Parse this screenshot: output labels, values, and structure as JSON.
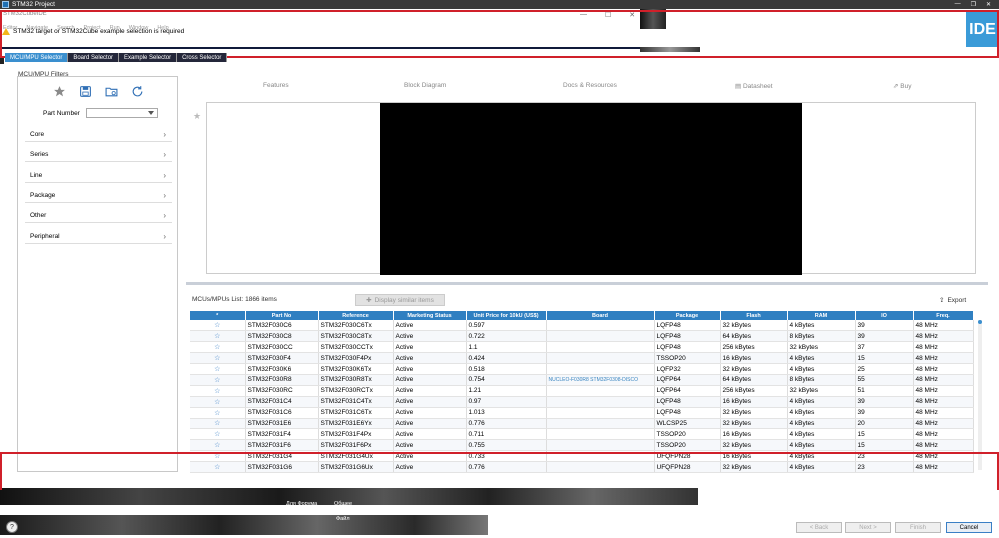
{
  "window": {
    "title": "STM32 Project"
  },
  "app": {
    "ide_name": "STM32CubeIDE",
    "menu": [
      "Editor",
      "Navigate",
      "Search",
      "Project",
      "Run",
      "Window",
      "Help"
    ],
    "badge": "IDE"
  },
  "wizard": {
    "warning": "STM32 target or STM32Cube example selection is required",
    "tabs": [
      "MCU/MPU Selector",
      "Board Selector",
      "Example Selector",
      "Cross Selector"
    ],
    "active_tab_index": 0
  },
  "filters": {
    "title": "MCU/MPU Filters",
    "icons": [
      "star-icon",
      "save-icon",
      "open-folder-icon",
      "reset-icon"
    ],
    "part_number_label": "Part Number",
    "part_number_value": "",
    "items": [
      "Core",
      "Series",
      "Line",
      "Package",
      "Other",
      "Peripheral"
    ]
  },
  "detail_tabs": [
    "Features",
    "Block Diagram",
    "Docs & Resources",
    "Datasheet",
    "Buy"
  ],
  "list": {
    "header": "MCUs/MPUs List: 1866 items",
    "display_similar": "Display similar items",
    "export": "Export",
    "columns": [
      "*",
      "Part No",
      "Reference",
      "Marketing Status",
      "Unit Price for 10kU (US$)",
      "Board",
      "Package",
      "Flash",
      "RAM",
      "IO",
      "Freq."
    ],
    "rows": [
      [
        "☆",
        "STM32F030C6",
        "STM32F030C6Tx",
        "Active",
        "0.597",
        "",
        "LQFP48",
        "32 kBytes",
        "4 kBytes",
        "39",
        "48 MHz"
      ],
      [
        "☆",
        "STM32F030C8",
        "STM32F030C8Tx",
        "Active",
        "0.722",
        "",
        "LQFP48",
        "64 kBytes",
        "8 kBytes",
        "39",
        "48 MHz"
      ],
      [
        "☆",
        "STM32F030CC",
        "STM32F030CCTx",
        "Active",
        "1.1",
        "",
        "LQFP48",
        "256 kBytes",
        "32 kBytes",
        "37",
        "48 MHz"
      ],
      [
        "☆",
        "STM32F030F4",
        "STM32F030F4Px",
        "Active",
        "0.424",
        "",
        "TSSOP20",
        "16 kBytes",
        "4 kBytes",
        "15",
        "48 MHz"
      ],
      [
        "☆",
        "STM32F030K6",
        "STM32F030K6Tx",
        "Active",
        "0.518",
        "",
        "LQFP32",
        "32 kBytes",
        "4 kBytes",
        "25",
        "48 MHz"
      ],
      [
        "☆",
        "STM32F030R8",
        "STM32F030R8Tx",
        "Active",
        "0.754",
        "NUCLEO-F030R8    STM32F0308-DISCO",
        "LQFP64",
        "64 kBytes",
        "8 kBytes",
        "55",
        "48 MHz"
      ],
      [
        "☆",
        "STM32F030RC",
        "STM32F030RCTx",
        "Active",
        "1.21",
        "",
        "LQFP64",
        "256 kBytes",
        "32 kBytes",
        "51",
        "48 MHz"
      ],
      [
        "☆",
        "STM32F031C4",
        "STM32F031C4Tx",
        "Active",
        "0.97",
        "",
        "LQFP48",
        "16 kBytes",
        "4 kBytes",
        "39",
        "48 MHz"
      ],
      [
        "☆",
        "STM32F031C6",
        "STM32F031C6Tx",
        "Active",
        "1.013",
        "",
        "LQFP48",
        "32 kBytes",
        "4 kBytes",
        "39",
        "48 MHz"
      ],
      [
        "☆",
        "STM32F031E6",
        "STM32F031E6Yx",
        "Active",
        "0.776",
        "",
        "WLCSP25",
        "32 kBytes",
        "4 kBytes",
        "20",
        "48 MHz"
      ],
      [
        "☆",
        "STM32F031F4",
        "STM32F031F4Px",
        "Active",
        "0.711",
        "",
        "TSSOP20",
        "16 kBytes",
        "4 kBytes",
        "15",
        "48 MHz"
      ],
      [
        "☆",
        "STM32F031F6",
        "STM32F031F6Px",
        "Active",
        "0.755",
        "",
        "TSSOP20",
        "32 kBytes",
        "4 kBytes",
        "15",
        "48 MHz"
      ],
      [
        "☆",
        "STM32F031G4",
        "STM32F031G4Ux",
        "Active",
        "0.733",
        "",
        "UFQFPN28",
        "16 kBytes",
        "4 kBytes",
        "23",
        "48 MHz"
      ],
      [
        "☆",
        "STM32F031G6",
        "STM32F031G6Ux",
        "Active",
        "0.776",
        "",
        "UFQFPN28",
        "32 kBytes",
        "4 kBytes",
        "23",
        "48 MHz"
      ]
    ]
  },
  "taskbar": {
    "label_1": "Для Форума",
    "label_2": "Общее",
    "label_3": "Файл"
  },
  "footer": {
    "help": "?",
    "back": "< Back",
    "next": "Next >",
    "finish": "Finish",
    "cancel": "Cancel"
  },
  "colors": {
    "accent": "#2f7fc1",
    "highlight": "#d0202a",
    "tab_active": "#3a8fcf"
  }
}
